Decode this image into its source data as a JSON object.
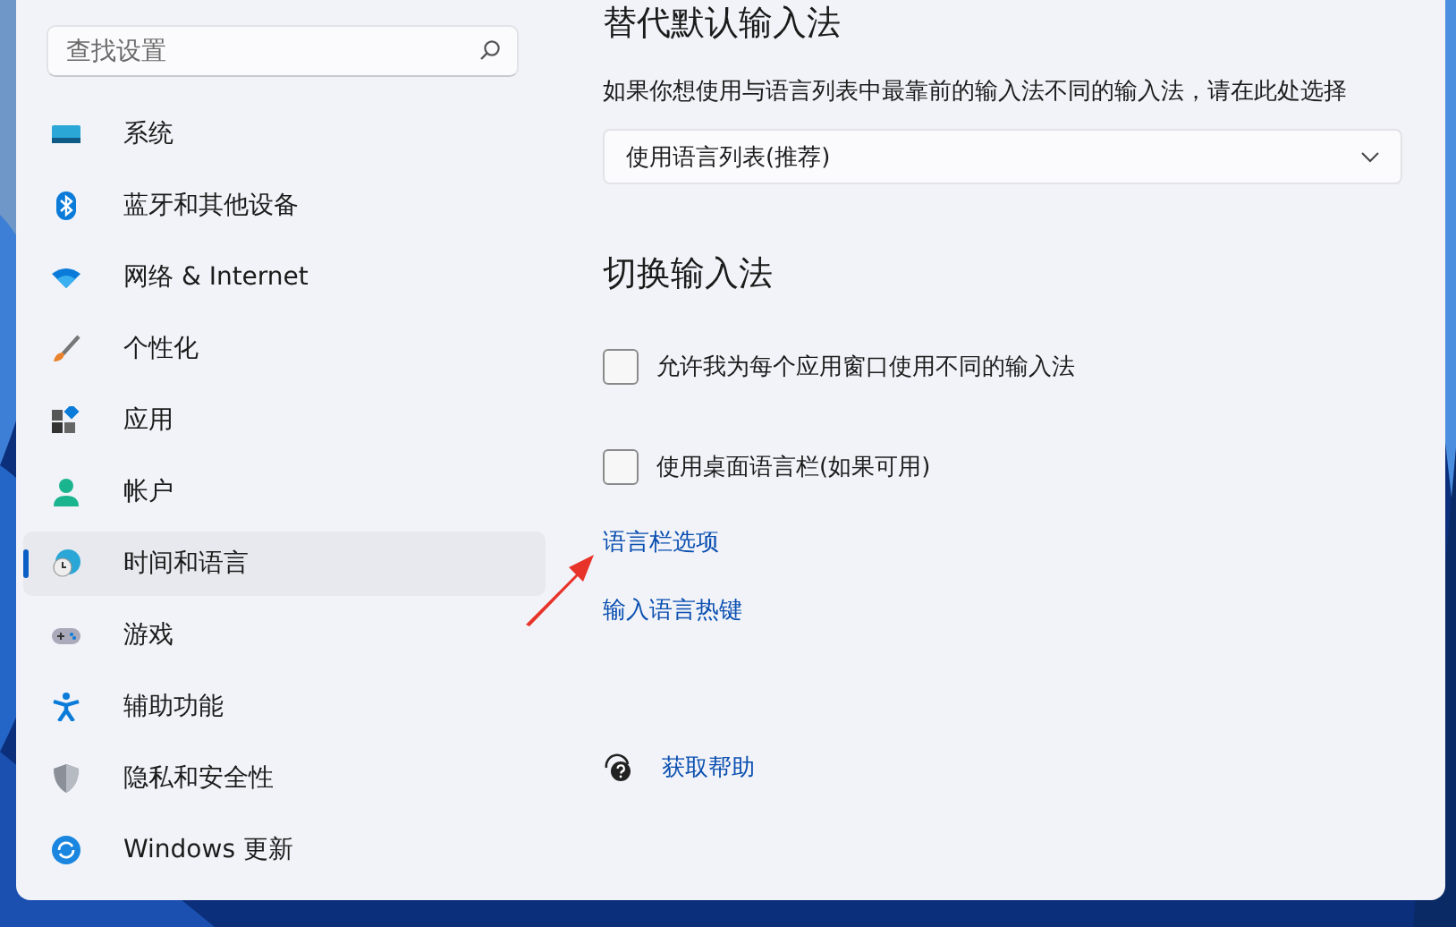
{
  "search": {
    "placeholder": "查找设置"
  },
  "sidebar": {
    "items": [
      {
        "label": "系统",
        "kind": "system",
        "selected": false
      },
      {
        "label": "蓝牙和其他设备",
        "kind": "bluetooth",
        "selected": false
      },
      {
        "label": "网络 & Internet",
        "kind": "network",
        "selected": false
      },
      {
        "label": "个性化",
        "kind": "personalize",
        "selected": false
      },
      {
        "label": "应用",
        "kind": "apps",
        "selected": false
      },
      {
        "label": "帐户",
        "kind": "account",
        "selected": false
      },
      {
        "label": "时间和语言",
        "kind": "time",
        "selected": true
      },
      {
        "label": "游戏",
        "kind": "gaming",
        "selected": false
      },
      {
        "label": "辅助功能",
        "kind": "accessibility",
        "selected": false
      },
      {
        "label": "隐私和安全性",
        "kind": "privacy",
        "selected": false
      },
      {
        "label": "Windows 更新",
        "kind": "update",
        "selected": false
      }
    ]
  },
  "default_input": {
    "heading": "替代默认输入法",
    "description": "如果你想使用与语言列表中最靠前的输入法不同的输入法，请在此处选择",
    "dropdown": {
      "value": "使用语言列表(推荐)"
    }
  },
  "switch_input": {
    "heading": "切换输入法",
    "options": [
      {
        "label": "允许我为每个应用窗口使用不同的输入法",
        "checked": false
      },
      {
        "label": "使用桌面语言栏(如果可用)",
        "checked": false
      }
    ],
    "links": [
      "语言栏选项",
      "输入语言热键"
    ]
  },
  "help": {
    "label": "获取帮助"
  }
}
